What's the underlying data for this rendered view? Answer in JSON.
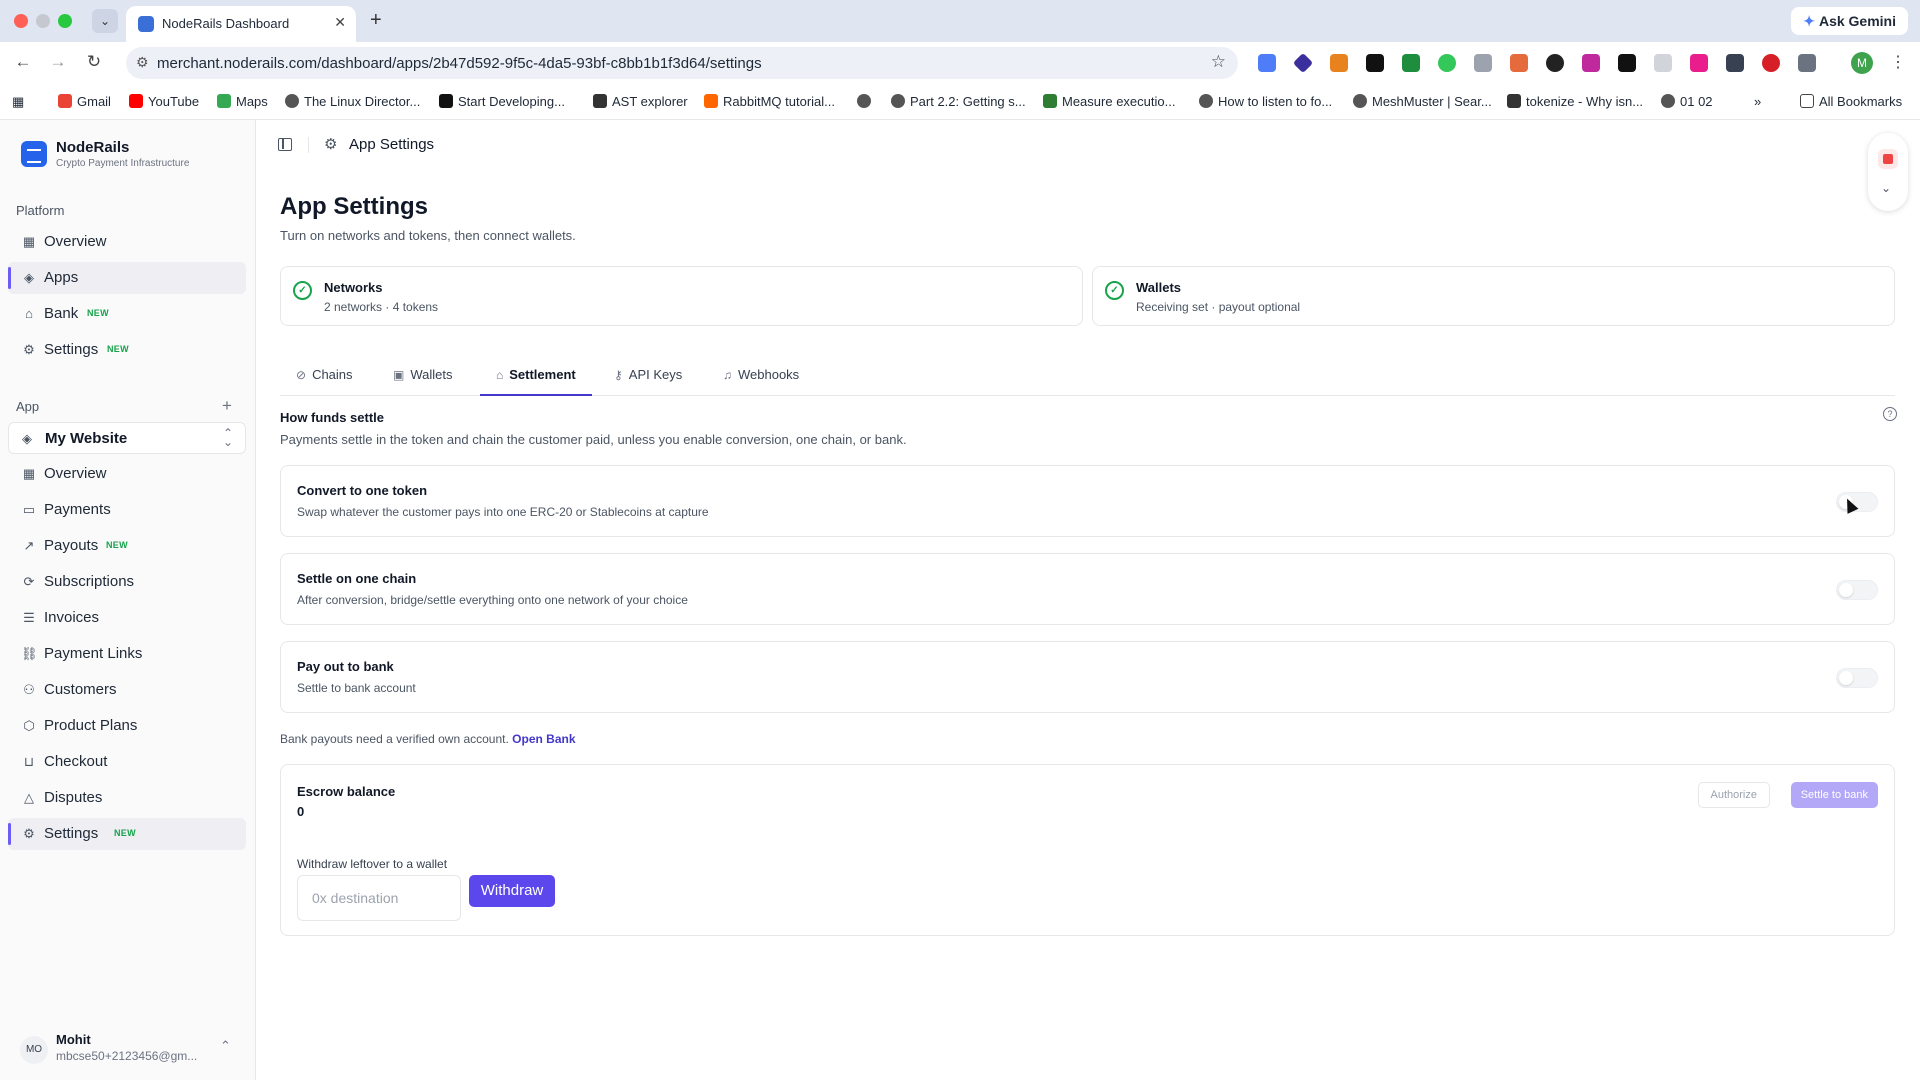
{
  "browser": {
    "tab_title": "NodeRails Dashboard",
    "ask_gemini": "Ask Gemini",
    "url": "merchant.noderails.com/dashboard/apps/2b47d592-9f5c-4da5-93bf-c8bb1b1f3d64/settings",
    "profile_initial": "M",
    "bookmarks": [
      {
        "label": "Gmail",
        "color": "#ea4335"
      },
      {
        "label": "YouTube",
        "color": "#ff0000"
      },
      {
        "label": "Maps",
        "color": "#34a853"
      },
      {
        "label": "The Linux Director...",
        "color": "#555555"
      },
      {
        "label": "Start Developing...",
        "color": "#111111"
      },
      {
        "label": "AST explorer",
        "color": "#333333"
      },
      {
        "label": "RabbitMQ tutorial...",
        "color": "#ff6600"
      },
      {
        "label": "",
        "color": "#555555"
      },
      {
        "label": "Part 2.2: Getting s...",
        "color": "#555555"
      },
      {
        "label": "Measure executio...",
        "color": "#2e7d32"
      },
      {
        "label": "How to listen to fo...",
        "color": "#555555"
      },
      {
        "label": "MeshMuster | Sear...",
        "color": "#555555"
      },
      {
        "label": "tokenize - Why isn...",
        "color": "#333333"
      },
      {
        "label": "01 02",
        "color": "#555555"
      }
    ],
    "all_bookmarks": "All Bookmarks"
  },
  "sidebar": {
    "brand": {
      "name": "NodeRails",
      "tagline": "Crypto Payment Infrastructure"
    },
    "platform_label": "Platform",
    "platform_items": [
      {
        "label": "Overview",
        "icon": "grid-icon",
        "new": ""
      },
      {
        "label": "Apps",
        "icon": "layers-icon",
        "new": "",
        "active": true
      },
      {
        "label": "Bank",
        "icon": "bank-icon",
        "new": "NEW"
      },
      {
        "label": "Settings",
        "icon": "gear-icon",
        "new": "NEW"
      }
    ],
    "app_label": "App",
    "app_selector": "My Website",
    "app_items": [
      {
        "label": "Overview",
        "icon": "grid-icon",
        "new": ""
      },
      {
        "label": "Payments",
        "icon": "card-icon",
        "new": ""
      },
      {
        "label": "Payouts",
        "icon": "arrow-up-right-icon",
        "new": "NEW"
      },
      {
        "label": "Subscriptions",
        "icon": "refresh-icon",
        "new": ""
      },
      {
        "label": "Invoices",
        "icon": "receipt-icon",
        "new": ""
      },
      {
        "label": "Payment Links",
        "icon": "link-icon",
        "new": ""
      },
      {
        "label": "Customers",
        "icon": "users-icon",
        "new": ""
      },
      {
        "label": "Product Plans",
        "icon": "package-icon",
        "new": ""
      },
      {
        "label": "Checkout",
        "icon": "cart-icon",
        "new": ""
      },
      {
        "label": "Disputes",
        "icon": "warning-icon",
        "new": ""
      },
      {
        "label": "Settings",
        "icon": "gear-icon",
        "new": "NEW",
        "active": true
      }
    ],
    "user": {
      "initials": "MO",
      "name": "Mohit",
      "email": "mbcse50+2123456@gm..."
    }
  },
  "header": {
    "title": "App Settings"
  },
  "page": {
    "title": "App Settings",
    "subtitle": "Turn on networks and tokens, then connect wallets."
  },
  "status_cards": {
    "networks": {
      "title": "Networks",
      "sub": "2 networks · 4 tokens"
    },
    "wallets": {
      "title": "Wallets",
      "sub": "Receiving set · payout optional"
    }
  },
  "tabs": [
    {
      "label": "Chains",
      "icon": "link-icon"
    },
    {
      "label": "Wallets",
      "icon": "wallet-icon"
    },
    {
      "label": "Settlement",
      "icon": "bank-icon",
      "active": true
    },
    {
      "label": "API Keys",
      "icon": "key-icon"
    },
    {
      "label": "Webhooks",
      "icon": "bell-icon"
    }
  ],
  "settlement": {
    "title": "How funds settle",
    "subtitle": "Payments settle in the token and chain the customer paid, unless you enable conversion, one chain, or bank.",
    "options": [
      {
        "title": "Convert to one token",
        "sub": "Swap whatever the customer pays into one ERC-20 or Stablecoins at capture",
        "enabled": false
      },
      {
        "title": "Settle on one chain",
        "sub": "After conversion, bridge/settle everything onto one network of your choice",
        "enabled": false
      },
      {
        "title": "Pay out to bank",
        "sub": "Settle to bank account",
        "enabled": false
      }
    ],
    "bank_note": "Bank payouts need a verified own account.",
    "bank_link": "Open Bank",
    "escrow": {
      "title": "Escrow balance",
      "value": "0",
      "authorize": "Authorize",
      "settle": "Settle to bank",
      "withdraw_label": "Withdraw leftover to a wallet",
      "withdraw_placeholder": "0x destination",
      "withdraw_value": "",
      "withdraw_button": "Withdraw"
    }
  },
  "colors": {
    "accent": "#5b47eb",
    "success": "#16a34a",
    "new_badge": "#16a34a"
  }
}
